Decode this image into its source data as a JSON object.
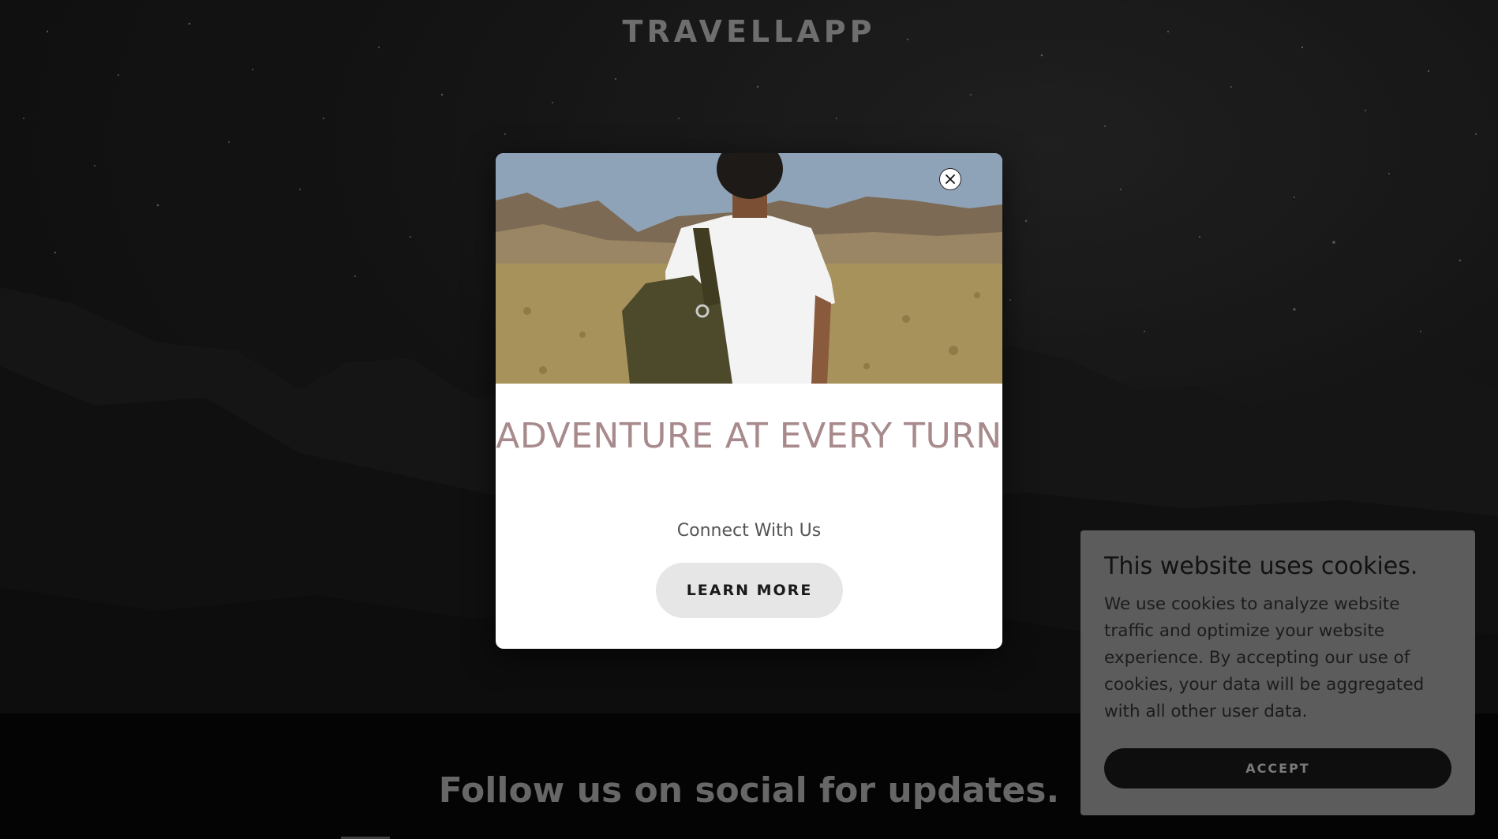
{
  "site": {
    "title": "TRAVELLAPP"
  },
  "modal": {
    "image_alt": "Traveler with backpack facing desert mountains",
    "close_icon": "close-icon",
    "title": "ADVENTURE AT EVERY TURN",
    "subtitle": "Connect With Us",
    "button_label": "LEARN MORE"
  },
  "footer": {
    "heading": "Follow us on social for updates."
  },
  "cookie_banner": {
    "title": "This website uses cookies.",
    "body": "We use cookies to analyze website traffic and optimize your website experience. By accepting our use of cookies, your data will be aggregated with all other user data.",
    "accept_label": "ACCEPT"
  },
  "colors": {
    "modal_title": "#a88a8c",
    "cookie_bg": "#5c5c5c",
    "accept_bg": "#0e0e0e",
    "learn_more_bg": "#e6e6e6"
  }
}
